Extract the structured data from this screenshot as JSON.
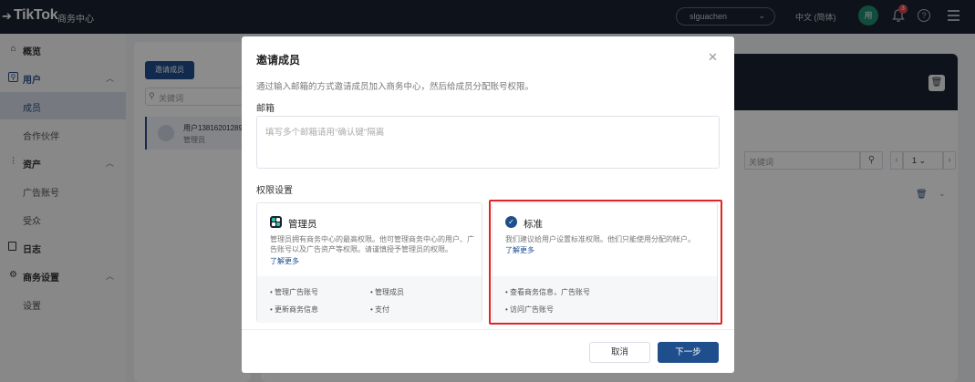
{
  "header": {
    "logo": "TikTok",
    "logo_sub": "商务中心",
    "account": "slguachen",
    "language": "中文 (简体)",
    "avatar_text": "用",
    "notification_count": "3"
  },
  "sidebar": {
    "items": [
      {
        "label": "概览",
        "icon": "home-icon"
      },
      {
        "label": "用户",
        "icon": "user-group-icon"
      },
      {
        "label": "成员"
      },
      {
        "label": "合作伙伴"
      },
      {
        "label": "资产",
        "icon": "assets-icon"
      },
      {
        "label": "广告账号"
      },
      {
        "label": "受众"
      },
      {
        "label": "日志",
        "icon": "log-icon"
      },
      {
        "label": "商务设置",
        "icon": "settings-icon"
      },
      {
        "label": "设置"
      }
    ]
  },
  "background": {
    "invite_button": "邀请成员",
    "keyword_placeholder": "关键词",
    "member_name": "用户13816201289",
    "member_role": "管理员",
    "page_value": "1"
  },
  "modal": {
    "title": "邀请成员",
    "description": "通过输入邮箱的方式邀请成员加入商务中心，然后给成员分配账号权限。",
    "email_label": "邮箱",
    "email_placeholder": "填写多个邮箱请用\"确认键\"隔离",
    "permission_label": "权限设置",
    "admin": {
      "title": "管理员",
      "description": "管理员拥有商务中心的最高权限。他可管理商务中心的用户、广告账号以及广告资产等权限。请谨慎授予管理员的权限。",
      "link": "了解更多",
      "perms": [
        "管理广告账号",
        "管理成员",
        "更新商务信息",
        "支付"
      ]
    },
    "standard": {
      "title": "标准",
      "description": "我们建议给用户设置标准权限。他们只能使用分配的帐户。",
      "link": "了解更多",
      "perms": [
        "查看商务信息，广告账号",
        "访问广告账号"
      ]
    },
    "cancel": "取消",
    "next": "下一步"
  }
}
